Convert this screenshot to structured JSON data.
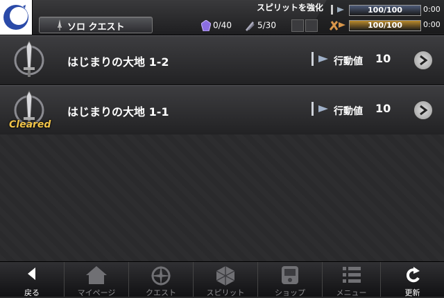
{
  "header": {
    "notice": "スピリットを強化",
    "title": "ソロ クエスト",
    "crystal_count": "0/40",
    "weapon_count": "5/30",
    "stamina": {
      "text": "100/100",
      "time": "0:00",
      "level": 1.0,
      "color": "#4d5b78"
    },
    "action": {
      "text": "100/100",
      "time": "0:00",
      "level": 1.0,
      "color": "#b98a2c"
    }
  },
  "quests": [
    {
      "name": "はじまりの大地 1-2",
      "cost_label": "行動値",
      "cost": "10",
      "cleared": ""
    },
    {
      "name": "はじまりの大地 1-1",
      "cost_label": "行動値",
      "cost": "10",
      "cleared": "Cleared"
    }
  ],
  "nav": {
    "back": "戻る",
    "mypage": "マイページ",
    "quest": "クエスト",
    "spirit": "スピリット",
    "shop": "ショップ",
    "menu": "メニュー",
    "refresh": "更新"
  },
  "icons": {
    "logo": "crescent-logo-icon",
    "crystal": "crystal-icon",
    "weapon": "weapon-icon",
    "emblem": "sword-emblem-icon",
    "arrow": "chevron-right-icon"
  },
  "colors": {
    "cleared": "#f2c54a",
    "crystal": "#8b6ee0"
  }
}
